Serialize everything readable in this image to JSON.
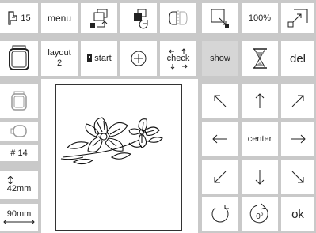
{
  "status": {
    "foot": "15",
    "color_count": "# 14",
    "height": "42mm",
    "width": "90mm"
  },
  "toolbar": {
    "menu": "menu",
    "layout_label": "layout",
    "layout_value": "2",
    "start": "start",
    "check": "check",
    "show": "show",
    "zoom": "100%",
    "del": "del"
  },
  "nav": {
    "center": "center",
    "rotate_label": "0°",
    "ok": "ok"
  },
  "icons": {
    "presser_foot": "presser-foot-icon",
    "hoop_large": "hoop-large-icon",
    "hoop_medium": "hoop-medium-icon",
    "hoop_small": "hoop-small-icon"
  }
}
